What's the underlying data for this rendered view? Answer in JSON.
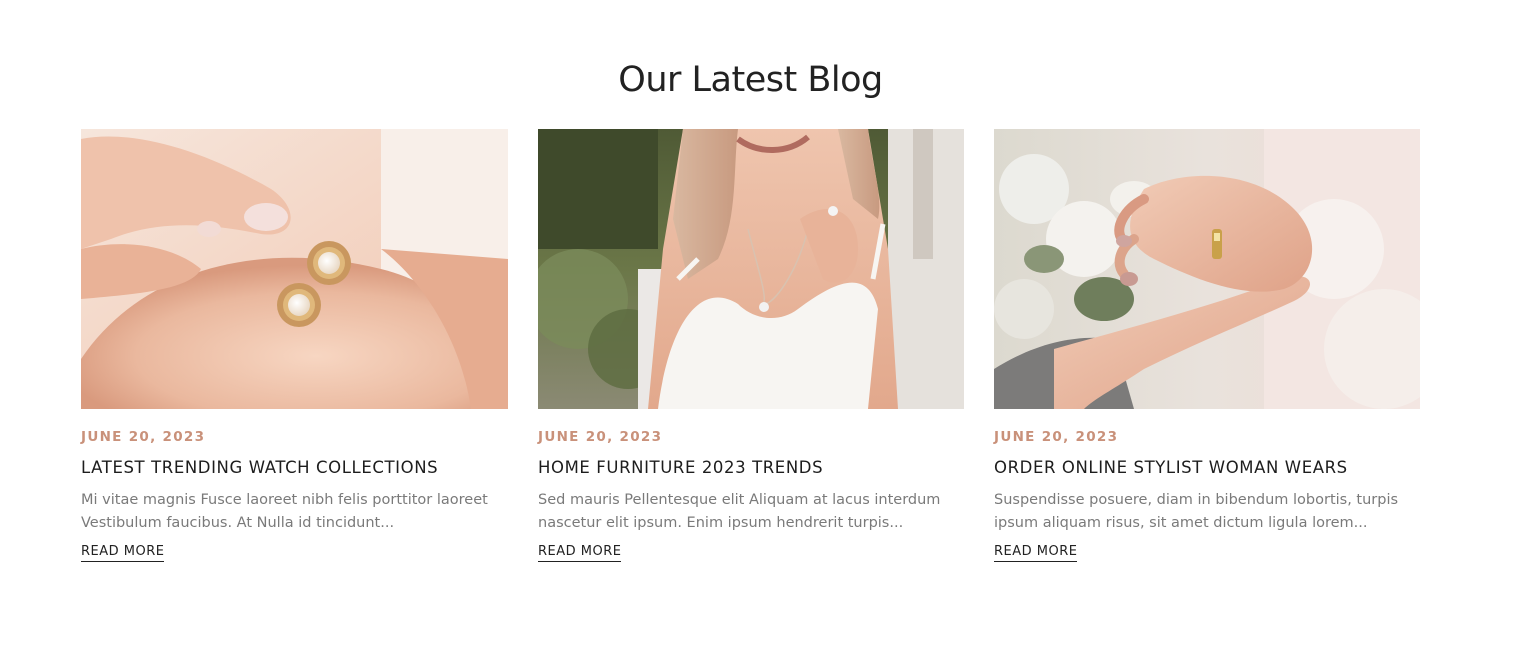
{
  "section": {
    "title": "Our Latest Blog"
  },
  "posts": [
    {
      "date": "JUNE 20, 2023",
      "title": "LATEST TRENDING WATCH COLLECTIONS",
      "excerpt": "Mi vitae magnis Fusce laoreet nibh felis porttitor laoreet Vestibulum faucibus. At Nulla id tincidunt...",
      "read_more": "READ MORE",
      "image": "pearl-earrings-in-palm"
    },
    {
      "date": "JUNE 20, 2023",
      "title": "HOME FURNITURE 2023 TRENDS",
      "excerpt": "Sed mauris Pellentesque elit Aliquam at lacus interdum nascetur elit ipsum. Enim ipsum hendrerit turpis...",
      "read_more": "READ MORE",
      "image": "bride-with-necklace"
    },
    {
      "date": "JUNE 20, 2023",
      "title": "ORDER ONLINE STYLIST WOMAN WEARS",
      "excerpt": "Suspendisse posuere, diam in bibendum lobortis, turpis ipsum aliquam risus, sit amet dictum ligula lorem...",
      "read_more": "READ MORE",
      "image": "hands-with-wedding-ring"
    }
  ],
  "colors": {
    "accent": "#c9917a",
    "title": "#222222",
    "body": "#7a7a7a"
  }
}
